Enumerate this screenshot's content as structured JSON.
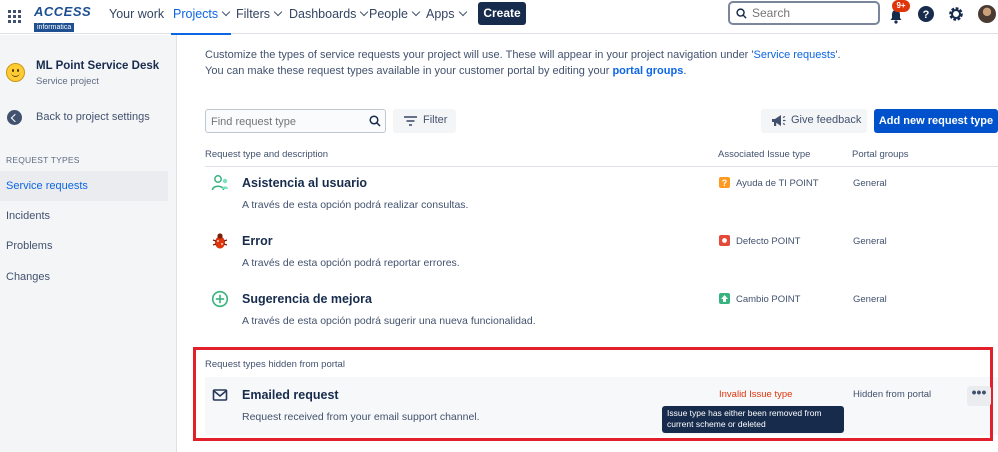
{
  "topnav": {
    "logo_line1": "ACCESS",
    "logo_line2": "informatica",
    "items": [
      {
        "label": "Your work",
        "has_chevron": false
      },
      {
        "label": "Projects",
        "has_chevron": true,
        "active": true
      },
      {
        "label": "Filters",
        "has_chevron": true
      },
      {
        "label": "Dashboards",
        "has_chevron": true
      },
      {
        "label": "People",
        "has_chevron": true
      },
      {
        "label": "Apps",
        "has_chevron": true
      }
    ],
    "create_label": "Create",
    "search_placeholder": "Search",
    "notification_badge": "9+",
    "icons": [
      "apps-grid-icon",
      "search-icon",
      "bell-icon",
      "help-icon",
      "gear-icon"
    ]
  },
  "sidebar": {
    "project_name": "ML Point Service Desk",
    "project_type": "Service project",
    "back_label": "Back to project settings",
    "section_heading": "REQUEST TYPES",
    "items": [
      {
        "label": "Service requests",
        "active": true
      },
      {
        "label": "Incidents"
      },
      {
        "label": "Problems"
      },
      {
        "label": "Changes"
      }
    ]
  },
  "main": {
    "intro_line1_pre": "Customize the types of service requests your project will use. These will appear in your project navigation under '",
    "intro_line1_link": "Service requests",
    "intro_line1_post": "'.",
    "intro_line2_pre": "You can make these request types available in your customer portal by editing your ",
    "intro_line2_link": "portal groups",
    "intro_line2_post": ".",
    "find_placeholder": "Find request type",
    "filter_label": "Filter",
    "feedback_label": "Give feedback",
    "add_label": "Add new request type",
    "columns": {
      "type": "Request type and description",
      "issue": "Associated Issue type",
      "portal": "Portal groups"
    },
    "rows": [
      {
        "icon": "person-icon",
        "title": "Asistencia al usuario",
        "description": "A través de esta opción podrá realizar consultas.",
        "issue_icon": "question-icon",
        "issue_color": "#ff991f",
        "issue_type": "Ayuda de TI POINT",
        "portal_group": "General"
      },
      {
        "icon": "bug-icon",
        "title": "Error",
        "description": "A través de esta opción podrá reportar errores.",
        "issue_icon": "bug-square-icon",
        "issue_color": "#e5493a",
        "issue_type": "Defecto POINT",
        "portal_group": "General"
      },
      {
        "icon": "plus-circle-icon",
        "title": "Sugerencia de mejora",
        "description": "A través de esta opción podrá sugerir una nueva funcionalidad.",
        "issue_icon": "arrow-up-icon",
        "issue_color": "#36b37e",
        "issue_type": "Cambio POINT",
        "portal_group": "General"
      }
    ],
    "hidden_heading": "Request types hidden from portal",
    "hidden_row": {
      "icon": "envelope-icon",
      "title": "Emailed request",
      "description": "Request received from your email support channel.",
      "issue_type": "Invalid Issue type",
      "portal_group": "Hidden from portal",
      "more_label": "•••"
    },
    "tooltip": "Issue type has either been removed from current scheme or deleted"
  }
}
